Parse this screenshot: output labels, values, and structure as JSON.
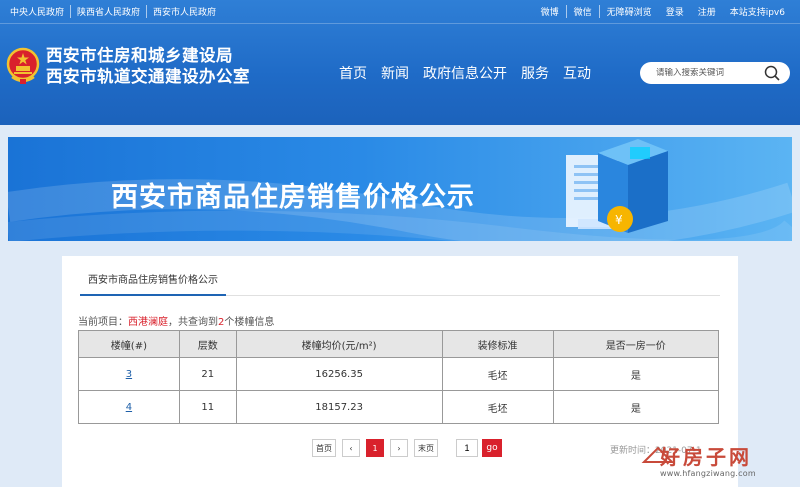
{
  "topbar": {
    "left_links": [
      "中央人民政府",
      "陕西省人民政府",
      "西安市人民政府"
    ],
    "right_links": [
      "微博",
      "微信",
      "无障碍浏览",
      "登录",
      "注册",
      "本站支持ipv6"
    ]
  },
  "brand": {
    "line1": "西安市住房和城乡建设局",
    "line2": "西安市轨道交通建设办公室"
  },
  "nav": [
    "首页",
    "新闻",
    "政府信息公开",
    "服务",
    "互动"
  ],
  "search": {
    "placeholder": "请输入搜索关键词"
  },
  "banner": {
    "title": "西安市商品住房销售价格公示"
  },
  "tab": {
    "label": "西安市商品住房销售价格公示"
  },
  "info": {
    "prefix": "当前项目：",
    "project": "西港澜庭",
    "middle": "，共查询到",
    "count": "2",
    "suffix": "个楼幢信息"
  },
  "table": {
    "headers": [
      "楼幢(#)",
      "层数",
      "楼幢均价(元/m²)",
      "装修标准",
      "是否一房一价"
    ],
    "rows": [
      [
        "3",
        "21",
        "16256.35",
        "毛坯",
        "是"
      ],
      [
        "4",
        "11",
        "18157.23",
        "毛坯",
        "是"
      ]
    ]
  },
  "pager": {
    "first": "首页",
    "prev": "‹",
    "current": "1",
    "next": "›",
    "last": "末页",
    "input_value": "1",
    "go": "go"
  },
  "update": "更新时间：2021-07-1",
  "watermark": {
    "text": "好房子网",
    "url": "www.hfangziwang.com"
  },
  "colors": {
    "header_blue": "#1f6bc7",
    "accent_red": "#d9212c",
    "link_blue": "#1e5fa8"
  }
}
